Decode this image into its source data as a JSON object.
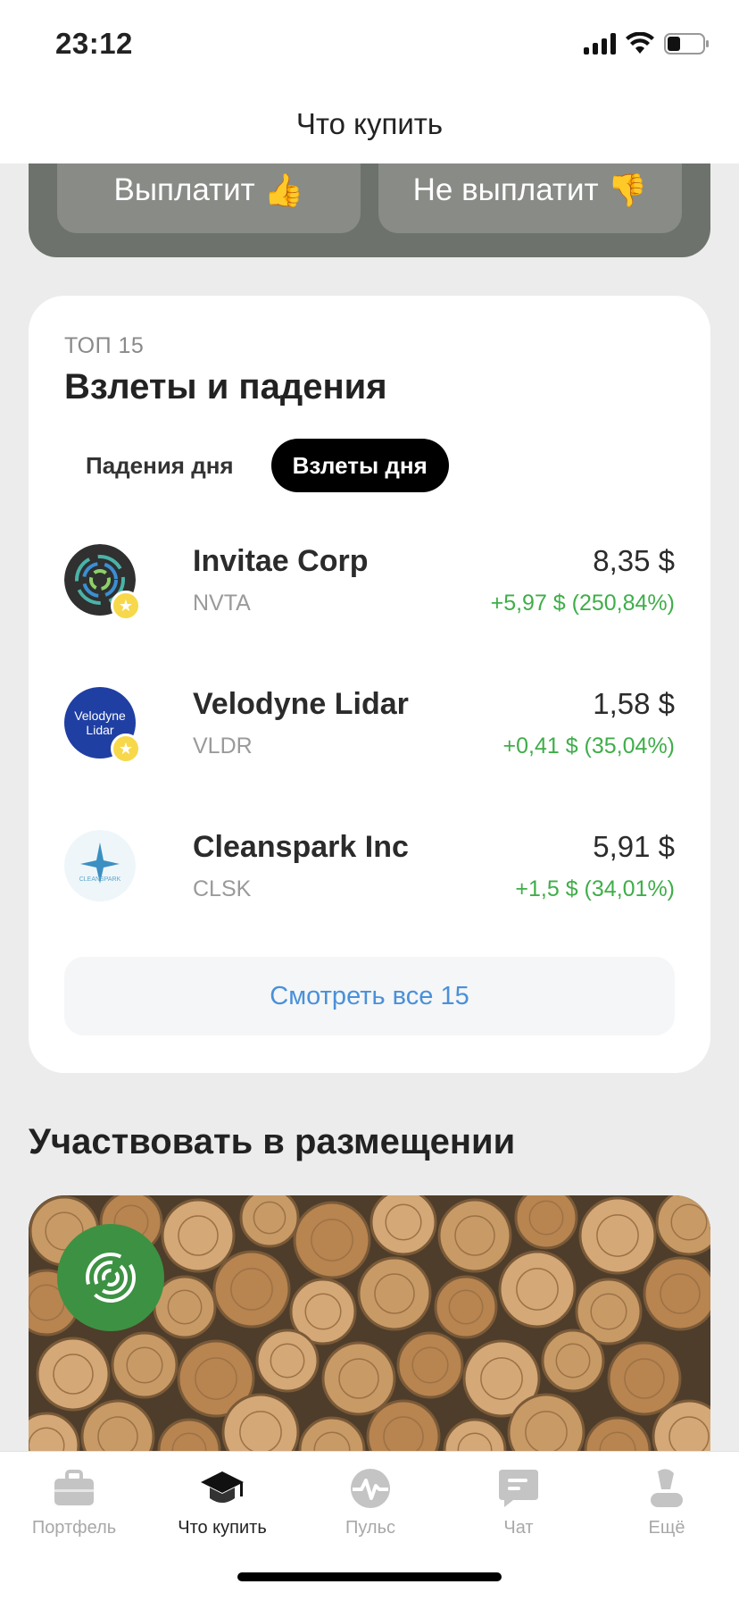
{
  "status_bar": {
    "time": "23:12"
  },
  "header": {
    "title": "Что купить"
  },
  "poll": {
    "yes_label": "Выплатит",
    "no_label": "Не выплатит"
  },
  "top15": {
    "label": "ТОП 15",
    "title": "Взлеты и падения",
    "tabs": [
      {
        "label": "Падения дня",
        "active": false
      },
      {
        "label": "Взлеты дня",
        "active": true
      }
    ],
    "stocks": [
      {
        "name": "Invitae Corp",
        "ticker": "NVTA",
        "price": "8,35 $",
        "change": "+5,97 $ (250,84%)",
        "favorite": true,
        "logo_text": ""
      },
      {
        "name": "Velodyne Lidar",
        "ticker": "VLDR",
        "price": "1,58 $",
        "change": "+0,41 $ (35,04%)",
        "favorite": true,
        "logo_text": "Velodyne Lidar"
      },
      {
        "name": "Cleanspark Inc",
        "ticker": "CLSK",
        "price": "5,91 $",
        "change": "+1,5 $ (34,01%)",
        "favorite": false,
        "logo_text": "CLEANSPARK"
      }
    ],
    "see_all_label": "Смотреть все 15"
  },
  "placement": {
    "title": "Участвовать в размещении"
  },
  "tabbar": {
    "items": [
      {
        "label": "Портфель",
        "icon": "briefcase-icon",
        "active": false
      },
      {
        "label": "Что купить",
        "icon": "graduation-cap-icon",
        "active": true
      },
      {
        "label": "Пульс",
        "icon": "pulse-icon",
        "active": false
      },
      {
        "label": "Чат",
        "icon": "chat-icon",
        "active": false
      },
      {
        "label": "Ещё",
        "icon": "profile-icon",
        "active": false
      }
    ]
  },
  "colors": {
    "accent_link": "#4a90d9",
    "positive": "#3fae49",
    "active_tab": "#000000",
    "poll_bg": "#6e726c"
  }
}
